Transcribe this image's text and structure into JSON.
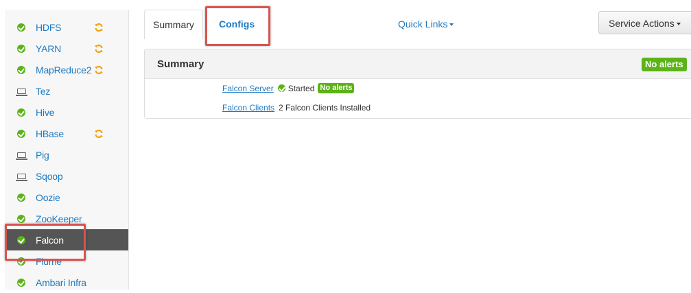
{
  "sidebar": {
    "services": [
      {
        "label": "HDFS",
        "status": "ok",
        "refresh": true
      },
      {
        "label": "YARN",
        "status": "ok",
        "refresh": true
      },
      {
        "label": "MapReduce2",
        "status": "ok",
        "refresh": true
      },
      {
        "label": "Tez",
        "status": "client",
        "refresh": false
      },
      {
        "label": "Hive",
        "status": "ok",
        "refresh": false
      },
      {
        "label": "HBase",
        "status": "ok",
        "refresh": true
      },
      {
        "label": "Pig",
        "status": "client",
        "refresh": false
      },
      {
        "label": "Sqoop",
        "status": "client",
        "refresh": false
      },
      {
        "label": "Oozie",
        "status": "ok",
        "refresh": false
      },
      {
        "label": "ZooKeeper",
        "status": "ok",
        "refresh": false
      },
      {
        "label": "Falcon",
        "status": "ok",
        "refresh": false,
        "active": true
      },
      {
        "label": "Flume",
        "status": "ok",
        "refresh": false
      },
      {
        "label": "Ambari Infra",
        "status": "ok",
        "refresh": false
      }
    ]
  },
  "tabs": {
    "summary": "Summary",
    "configs": "Configs",
    "quick_links": "Quick Links",
    "service_actions": "Service Actions"
  },
  "summary_panel": {
    "title": "Summary",
    "alerts_badge": "No alerts",
    "falcon_server": {
      "link": "Falcon Server",
      "status": "Started",
      "badge": "No alerts"
    },
    "falcon_clients": {
      "link": "Falcon Clients",
      "text": "2 Falcon Clients Installed"
    }
  },
  "colors": {
    "accent": "#1e7ac2",
    "ok": "#5cb318",
    "refresh": "#f0a30a",
    "highlight": "#d9534f",
    "active_bg": "#555555"
  },
  "icons": {
    "ok": "check-circle-icon",
    "client": "laptop-icon",
    "refresh": "refresh-icon"
  }
}
